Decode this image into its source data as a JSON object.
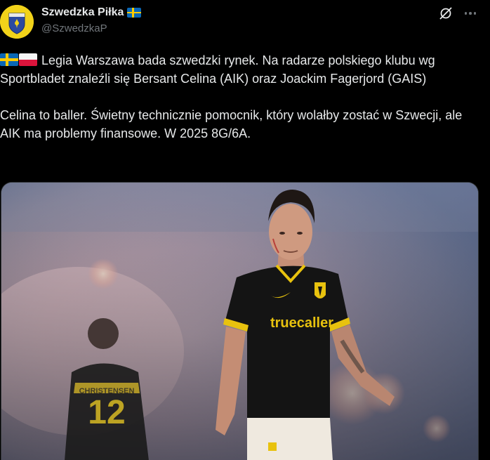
{
  "author": {
    "display_name": "Szwedzka Piłka",
    "handle": "@SzwedzkaP",
    "avatar_icon": "club-crest-avatar",
    "verified_flag": "sweden-flag-icon"
  },
  "actions": {
    "grok_icon": "grok-icon",
    "more_icon": "more-options-icon"
  },
  "tweet": {
    "line1_flags": [
      "sweden-flag-icon",
      "poland-flag-icon"
    ],
    "paragraph1": " Legia Warszawa bada szwedzki rynek. Na radarze polskiego klubu wg Sportbladet znaleźli się Bersant Celina (AIK) oraz Joackim Fagerjord (GAIS)",
    "paragraph2": "Celina to baller. Świetny technicznie pomocnik, który wolałby zostać w Szwecji, ale AIK ma problemy finansowe. W 2025 8G/6A."
  },
  "media": {
    "jersey_sponsor": "truecaller",
    "background_player_number": "12",
    "background_player_name": "CHRISTENSEN"
  },
  "colors": {
    "background": "#000000",
    "text_primary": "#e7e9ea",
    "text_secondary": "#71767b",
    "jersey_black": "#141414",
    "jersey_yellow": "#e8c20e"
  }
}
